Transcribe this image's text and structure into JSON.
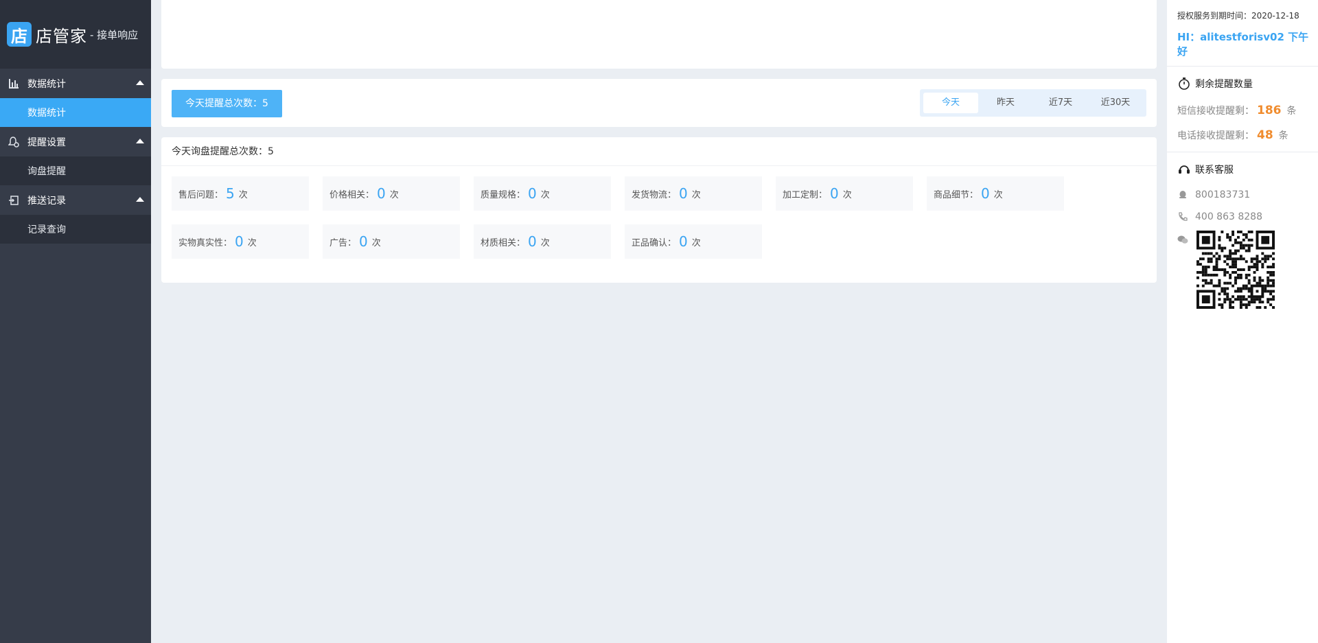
{
  "app": {
    "logo_glyph": "店",
    "name": "店管家",
    "subtitle": "- 接单响应"
  },
  "sidebar": {
    "groups": [
      {
        "label": "数据统计",
        "icon": "bar-chart-icon",
        "items": [
          {
            "label": "数据统计",
            "active": true
          }
        ]
      },
      {
        "label": "提醒设置",
        "icon": "bell-gear-icon",
        "items": [
          {
            "label": "询盘提醒",
            "active": false
          }
        ]
      },
      {
        "label": "推送记录",
        "icon": "push-record-icon",
        "items": [
          {
            "label": "记录查询",
            "active": false
          }
        ]
      }
    ]
  },
  "summary": {
    "total_label": "今天提醒总次数：5",
    "range_tabs": [
      "今天",
      "昨天",
      "近7天",
      "近30天"
    ],
    "active_tab": "今天"
  },
  "detail": {
    "title": "今天询盘提醒总次数：",
    "title_count": "5",
    "unit": "次",
    "stats": [
      {
        "label": "售后问题：",
        "value": "5"
      },
      {
        "label": "价格相关：",
        "value": "0"
      },
      {
        "label": "质量规格：",
        "value": "0"
      },
      {
        "label": "发货物流：",
        "value": "0"
      },
      {
        "label": "加工定制：",
        "value": "0"
      },
      {
        "label": "商品细节：",
        "value": "0"
      },
      {
        "label": "实物真实性：",
        "value": "0"
      },
      {
        "label": "广告：",
        "value": "0"
      },
      {
        "label": "材质相关：",
        "value": "0"
      },
      {
        "label": "正品确认：",
        "value": "0"
      }
    ]
  },
  "right_panel": {
    "expire": "授权服务到期时间：2020-12-18",
    "greeting": "HI：alitestforisv02 下午好",
    "remain": {
      "title": "剩余提醒数量",
      "sms_label": "短信接收提醒剩：",
      "sms_count": "186",
      "phone_label": "电话接收提醒剩：",
      "phone_count": "48",
      "unit": "条"
    },
    "contact": {
      "title": "联系客服",
      "qq": "800183731",
      "phone": "400 863 8288"
    }
  },
  "colors": {
    "accent": "#3aa4f2",
    "sidebar_bg": "#363c49",
    "highlight_orange": "#f08c2e"
  }
}
